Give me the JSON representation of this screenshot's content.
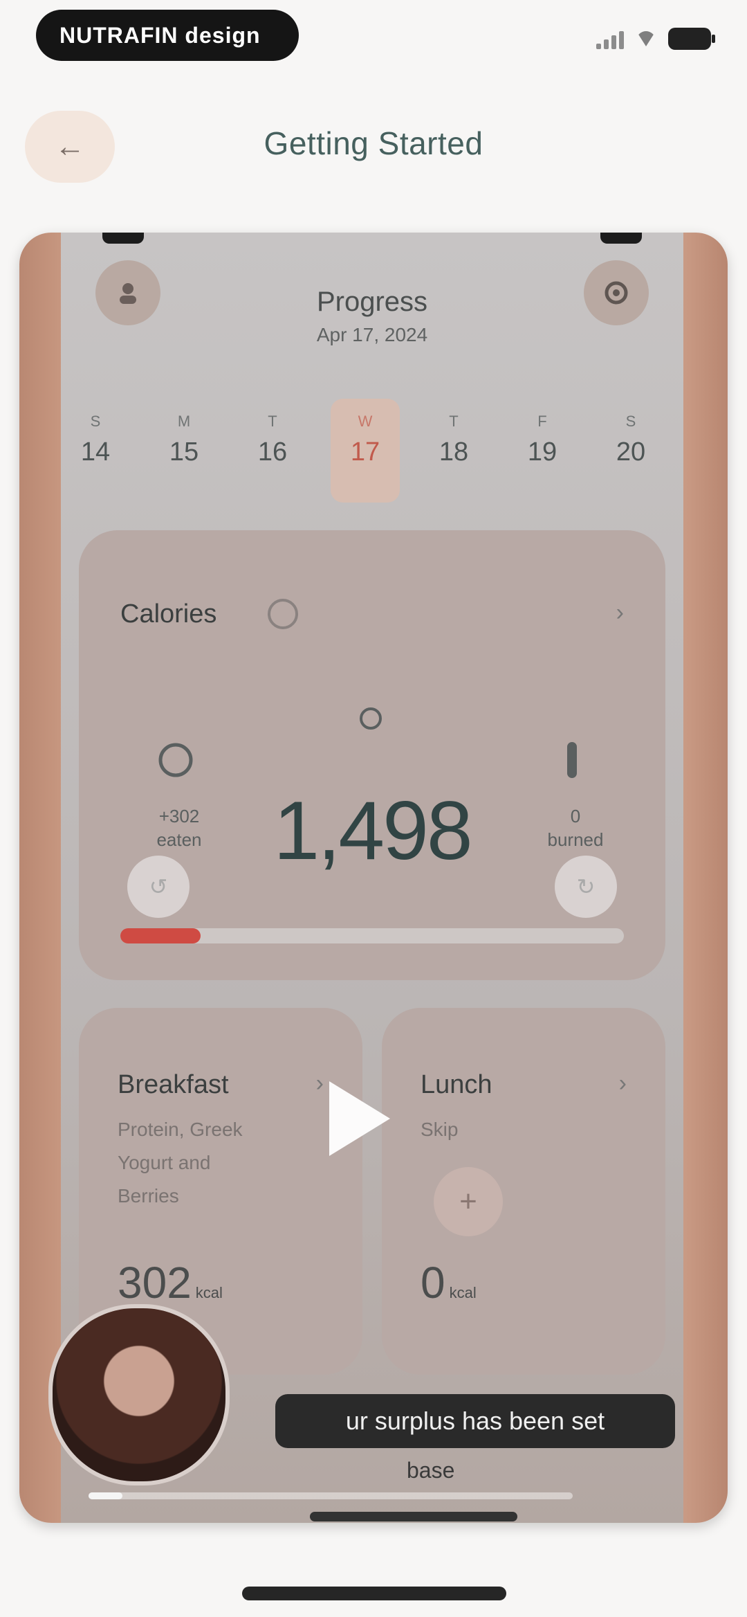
{
  "status_bar": {
    "pill_text": "NUTRAFIN design",
    "signal_icon": "signal-icon",
    "wifi_icon": "wifi-icon",
    "battery_icon": "battery-icon"
  },
  "header": {
    "back_icon": "arrow-left-icon",
    "back_symbol": "←",
    "title": "Getting Started"
  },
  "video": {
    "inner_app": {
      "title": "Progress",
      "date": "Apr 17, 2024",
      "week": [
        {
          "letter": "S",
          "num": "14"
        },
        {
          "letter": "M",
          "num": "15"
        },
        {
          "letter": "T",
          "num": "16"
        },
        {
          "letter": "W",
          "num": "17"
        },
        {
          "letter": "T",
          "num": "18"
        },
        {
          "letter": "F",
          "num": "19"
        },
        {
          "letter": "S",
          "num": "20"
        }
      ],
      "calories_card": {
        "title": "Calories",
        "value": "1,498",
        "left_value": "+302",
        "left_label": "eaten",
        "right_value": "0",
        "right_label": "burned",
        "progress": 0.16,
        "progress_color": "#cf4b43"
      },
      "breakfast_card": {
        "title": "Breakfast",
        "sub": [
          "Protein, Greek",
          "Yogurt and",
          "Berries"
        ],
        "kcal": "302",
        "unit": "kcal"
      },
      "lunch_card": {
        "title": "Lunch",
        "sub": "Skip",
        "kcal": "0",
        "unit": "kcal",
        "add_symbol": "+"
      }
    },
    "caption": "ur surplus has been set",
    "caption_line2": "base",
    "playback_progress": 0.07
  }
}
